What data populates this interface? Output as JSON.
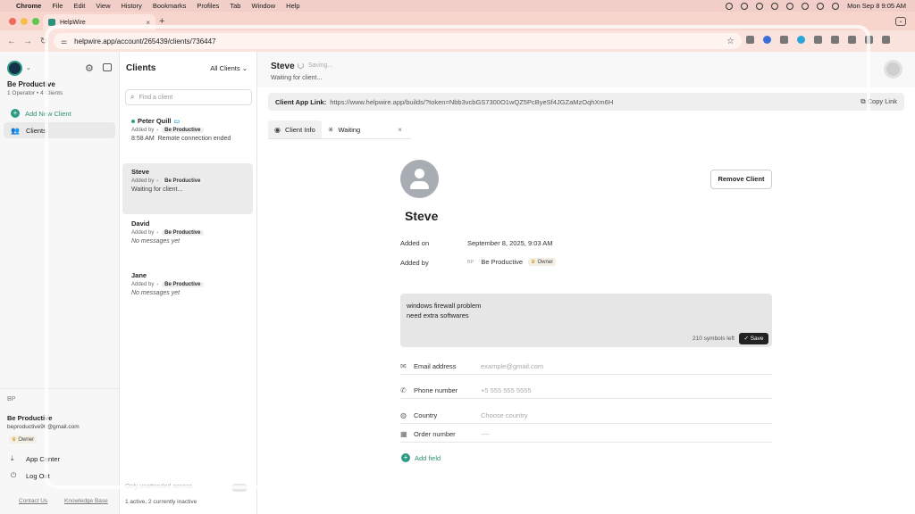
{
  "menubar": {
    "items": [
      "Chrome",
      "File",
      "Edit",
      "View",
      "History",
      "Bookmarks",
      "Profiles",
      "Tab",
      "Window",
      "Help"
    ],
    "clock": "Mon Sep 8  9:05 AM"
  },
  "browser": {
    "tab_title": "HelpWire",
    "tab_close": "×",
    "new_tab": "+",
    "url": "helpwire.app/account/265439/clients/736447"
  },
  "sidebar": {
    "org_name": "Be Productive",
    "org_meta": "1 Operator • 4 Clients",
    "add_client": "Add New Client",
    "nav_clients": "Clients",
    "user_initials": "BP",
    "user_name": "Be Productive",
    "user_email": "beproductive90@gmail.com",
    "user_role": "Owner",
    "app_center": "App Center",
    "log_out": "Log Out",
    "contact_us": "Contact Us",
    "knowledge_base": "Knowledge Base"
  },
  "clients_list": {
    "title": "Clients",
    "filter": "All Clients",
    "search_placeholder": "Find a client",
    "added_by_label": "Added by",
    "items": [
      {
        "name": "Peter Quill",
        "org": "Be Productive",
        "time": "8:58 AM",
        "message": "Remote connection ended"
      },
      {
        "name": "Steve",
        "org": "Be Productive",
        "message": "Waiting for client..."
      },
      {
        "name": "David",
        "org": "Be Productive",
        "message": "No messages yet"
      },
      {
        "name": "Jane",
        "org": "Be Productive",
        "message": "No messages yet"
      }
    ],
    "toggle_label": "Only unattended access",
    "status": "1 active, 2 currently inactive"
  },
  "main": {
    "client_name": "Steve",
    "saving": "Saving...",
    "waiting": "Waiting for client...",
    "link_label": "Client App Link:",
    "link_url": "https://www.helpwire.app/builds/?token=Nbb3vcbGS7300O1wQZ5PcByeSf4JGZaMzOqhXm6H",
    "copy_link": "Copy Link",
    "tab_info": "Client Info",
    "tab_waiting": "Waiting",
    "remove_client": "Remove Client",
    "added_on_label": "Added on",
    "added_on_value": "September 8, 2025, 9:03 AM",
    "added_by_label": "Added by",
    "added_by_initials": "BP",
    "added_by_value": "Be Productive",
    "added_by_role": "Owner",
    "note_line1": "windows firewall problem",
    "note_line2": "need extra softwares",
    "symbols_left": "210 symbols left",
    "save": "Save",
    "fields": [
      {
        "label": "Email address",
        "placeholder": "example@gmail.com"
      },
      {
        "label": "Phone number",
        "placeholder": "+5 555 555 5555"
      },
      {
        "label": "Country",
        "placeholder": "Choose country"
      },
      {
        "label": "Order number",
        "placeholder": "----"
      }
    ],
    "add_field": "Add field"
  },
  "colors": {
    "menubar_bg": "#f1cfc8",
    "accent_green": "#2f9b84",
    "online_dot": "#33a66f"
  }
}
